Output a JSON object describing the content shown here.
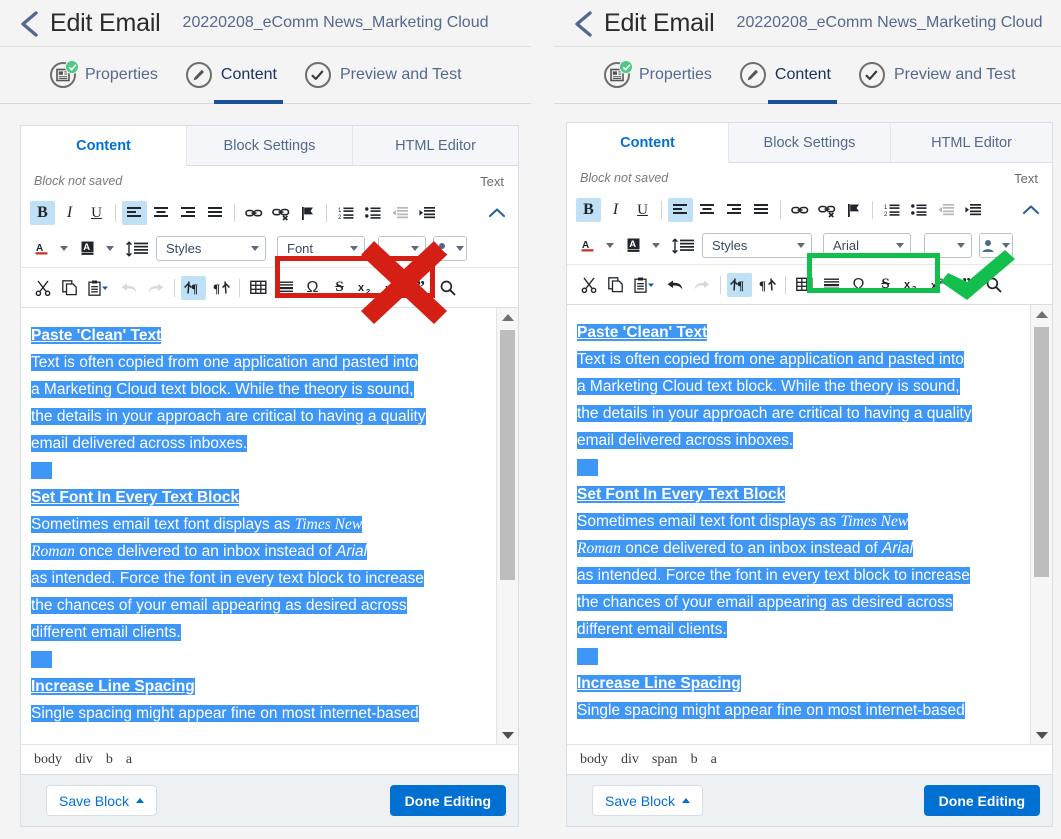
{
  "header": {
    "back_icon": "chevron-left-icon",
    "title": "Edit Email",
    "subtitle": "20220208_eComm News_Marketing Cloud"
  },
  "wizard": {
    "items": [
      {
        "label": "Properties",
        "icon": "properties-icon",
        "badge": "check-badge",
        "active": false
      },
      {
        "label": "Content",
        "icon": "pencil-icon",
        "badge": "",
        "active": true
      },
      {
        "label": "Preview and Test",
        "icon": "check-circle-icon",
        "badge": "",
        "active": false
      }
    ]
  },
  "editor": {
    "tabs": [
      {
        "label": "Content",
        "active": true
      },
      {
        "label": "Block Settings",
        "active": false
      },
      {
        "label": "HTML Editor",
        "active": false
      }
    ],
    "status_left": "Block not saved",
    "status_right": "Text",
    "toolbar_row1": [
      {
        "name": "bold-icon",
        "glyph": "B",
        "active": true
      },
      {
        "name": "italic-icon",
        "glyph": "I",
        "active": false
      },
      {
        "name": "underline-icon",
        "glyph": "U",
        "active": false
      },
      {
        "name": "align-left-icon",
        "glyph": "",
        "active": true
      },
      {
        "name": "align-center-icon",
        "glyph": "",
        "active": false
      },
      {
        "name": "align-right-icon",
        "glyph": "",
        "active": false
      },
      {
        "name": "align-justify-icon",
        "glyph": "",
        "active": false
      },
      {
        "name": "link-icon",
        "glyph": "",
        "active": false
      },
      {
        "name": "unlink-icon",
        "glyph": "",
        "active": false
      },
      {
        "name": "anchor-flag-icon",
        "glyph": "",
        "active": false
      },
      {
        "name": "numbered-list-icon",
        "glyph": "",
        "active": false
      },
      {
        "name": "bulleted-list-icon",
        "glyph": "",
        "active": false
      },
      {
        "name": "decrease-indent-icon",
        "glyph": "",
        "active": false,
        "disabled": true
      },
      {
        "name": "increase-indent-icon",
        "glyph": "",
        "active": false
      },
      {
        "name": "collapse-toolbar-icon",
        "glyph": "",
        "active": false
      }
    ],
    "toolbar_row2": {
      "text_color_label": "A",
      "bg_color_label": "A",
      "line_height_icon": "line-height-icon",
      "styles_value": "Styles",
      "font_value_left": "Font",
      "font_value_right": "Arial",
      "size_value": "",
      "personalization_icon": "personalization-icon"
    },
    "toolbar_row3": [
      {
        "name": "cut-icon"
      },
      {
        "name": "copy-icon"
      },
      {
        "name": "paste-icon"
      },
      {
        "name": "undo-icon"
      },
      {
        "name": "redo-icon"
      },
      {
        "name": "ltr-paragraph-icon"
      },
      {
        "name": "rtl-paragraph-icon"
      },
      {
        "name": "table-icon"
      },
      {
        "name": "horizontal-rule-icon"
      },
      {
        "name": "special-character-icon"
      },
      {
        "name": "strikethrough-icon"
      },
      {
        "name": "subscript-icon"
      },
      {
        "name": "superscript-icon"
      },
      {
        "name": "blockquote-icon"
      },
      {
        "name": "find-replace-icon"
      }
    ],
    "content": {
      "section1_heading": "Paste 'Clean' Text",
      "section1_lines": [
        "Text is often copied from one application and pasted into",
        "a Marketing Cloud text block. While the theory is sound,",
        "the details in your approach are critical to having a quality",
        "email delivered across inboxes."
      ],
      "section2_heading": "Set Font In Every Text Block",
      "section2_line1_a": "Sometimes email text font displays as ",
      "section2_line1_b": "Times New",
      "section2_line2_a": "Roman",
      "section2_line2_b": " once delivered to an inbox instead of ",
      "section2_line2_c": "Arial",
      "section2_lines_rest": [
        "as intended. Force the font in every text block to increase",
        "the chances of your email appearing as desired across",
        "different email clients."
      ],
      "section3_heading": "Increase Line Spacing",
      "section3_cut_line": "Single spacing might appear fine on most internet-based"
    },
    "element_path_left": [
      "body",
      "div",
      "b",
      "a"
    ],
    "element_path_right": [
      "body",
      "div",
      "span",
      "b",
      "a"
    ],
    "save_button": "Save Block",
    "done_button": "Done Editing"
  },
  "annotations": {
    "left_mark": "red-x-mark",
    "right_mark": "green-check-mark",
    "left_box_color": "#d61f14",
    "right_box_color": "#12bf4c"
  },
  "colors": {
    "accent_blue": "#0070d2",
    "selection_blue": "#3e97f6",
    "wizard_underline": "#1b5297",
    "badge_green": "#4bca81"
  }
}
